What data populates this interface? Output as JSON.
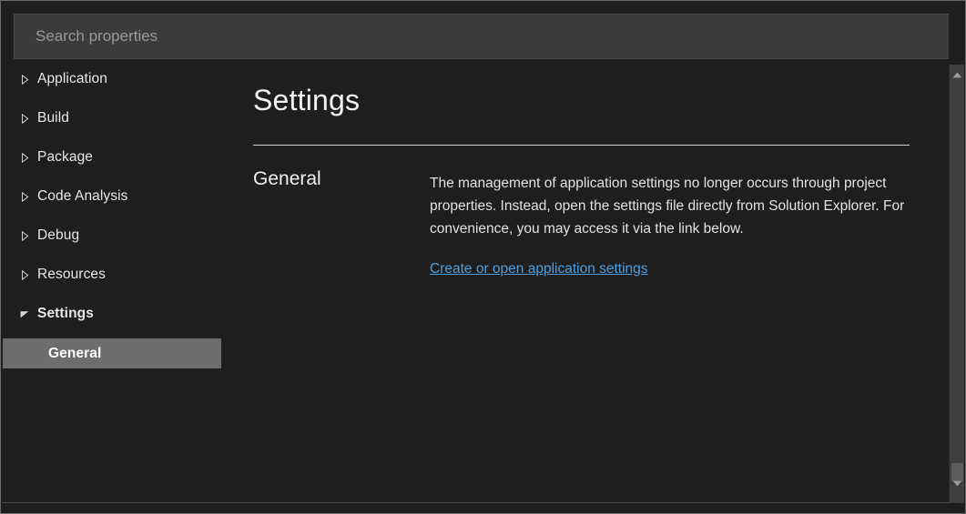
{
  "search": {
    "placeholder": "Search properties",
    "value": ""
  },
  "sidebar": {
    "items": [
      {
        "label": "Application",
        "state": "collapsed",
        "icon": "chevron-right-icon",
        "level": 0,
        "selected": false
      },
      {
        "label": "Build",
        "state": "collapsed",
        "icon": "chevron-right-icon",
        "level": 0,
        "selected": false
      },
      {
        "label": "Package",
        "state": "collapsed",
        "icon": "chevron-right-icon",
        "level": 0,
        "selected": false
      },
      {
        "label": "Code Analysis",
        "state": "collapsed",
        "icon": "chevron-right-icon",
        "level": 0,
        "selected": false
      },
      {
        "label": "Debug",
        "state": "collapsed",
        "icon": "chevron-right-icon",
        "level": 0,
        "selected": false
      },
      {
        "label": "Resources",
        "state": "collapsed",
        "icon": "chevron-right-icon",
        "level": 0,
        "selected": false
      },
      {
        "label": "Settings",
        "state": "expanded",
        "icon": "chevron-down-icon",
        "level": 0,
        "selected": false
      },
      {
        "label": "General",
        "state": "leaf",
        "icon": "none",
        "level": 1,
        "selected": true
      }
    ]
  },
  "content": {
    "title": "Settings",
    "section": {
      "label": "General",
      "description": "The management of application settings no longer occurs through project properties. Instead, open the settings file directly from Solution Explorer. For convenience, you may access it via the link below.",
      "link": "Create or open application settings"
    }
  },
  "scrollbar": {
    "up_icon": "triangle-up-icon",
    "down_icon": "triangle-down-icon"
  },
  "colors": {
    "background": "#1e1e1e",
    "selection": "#6d6d6d",
    "link": "#4f9fe0",
    "text": "#e8e8e8",
    "rule": "#d0d0d0"
  }
}
